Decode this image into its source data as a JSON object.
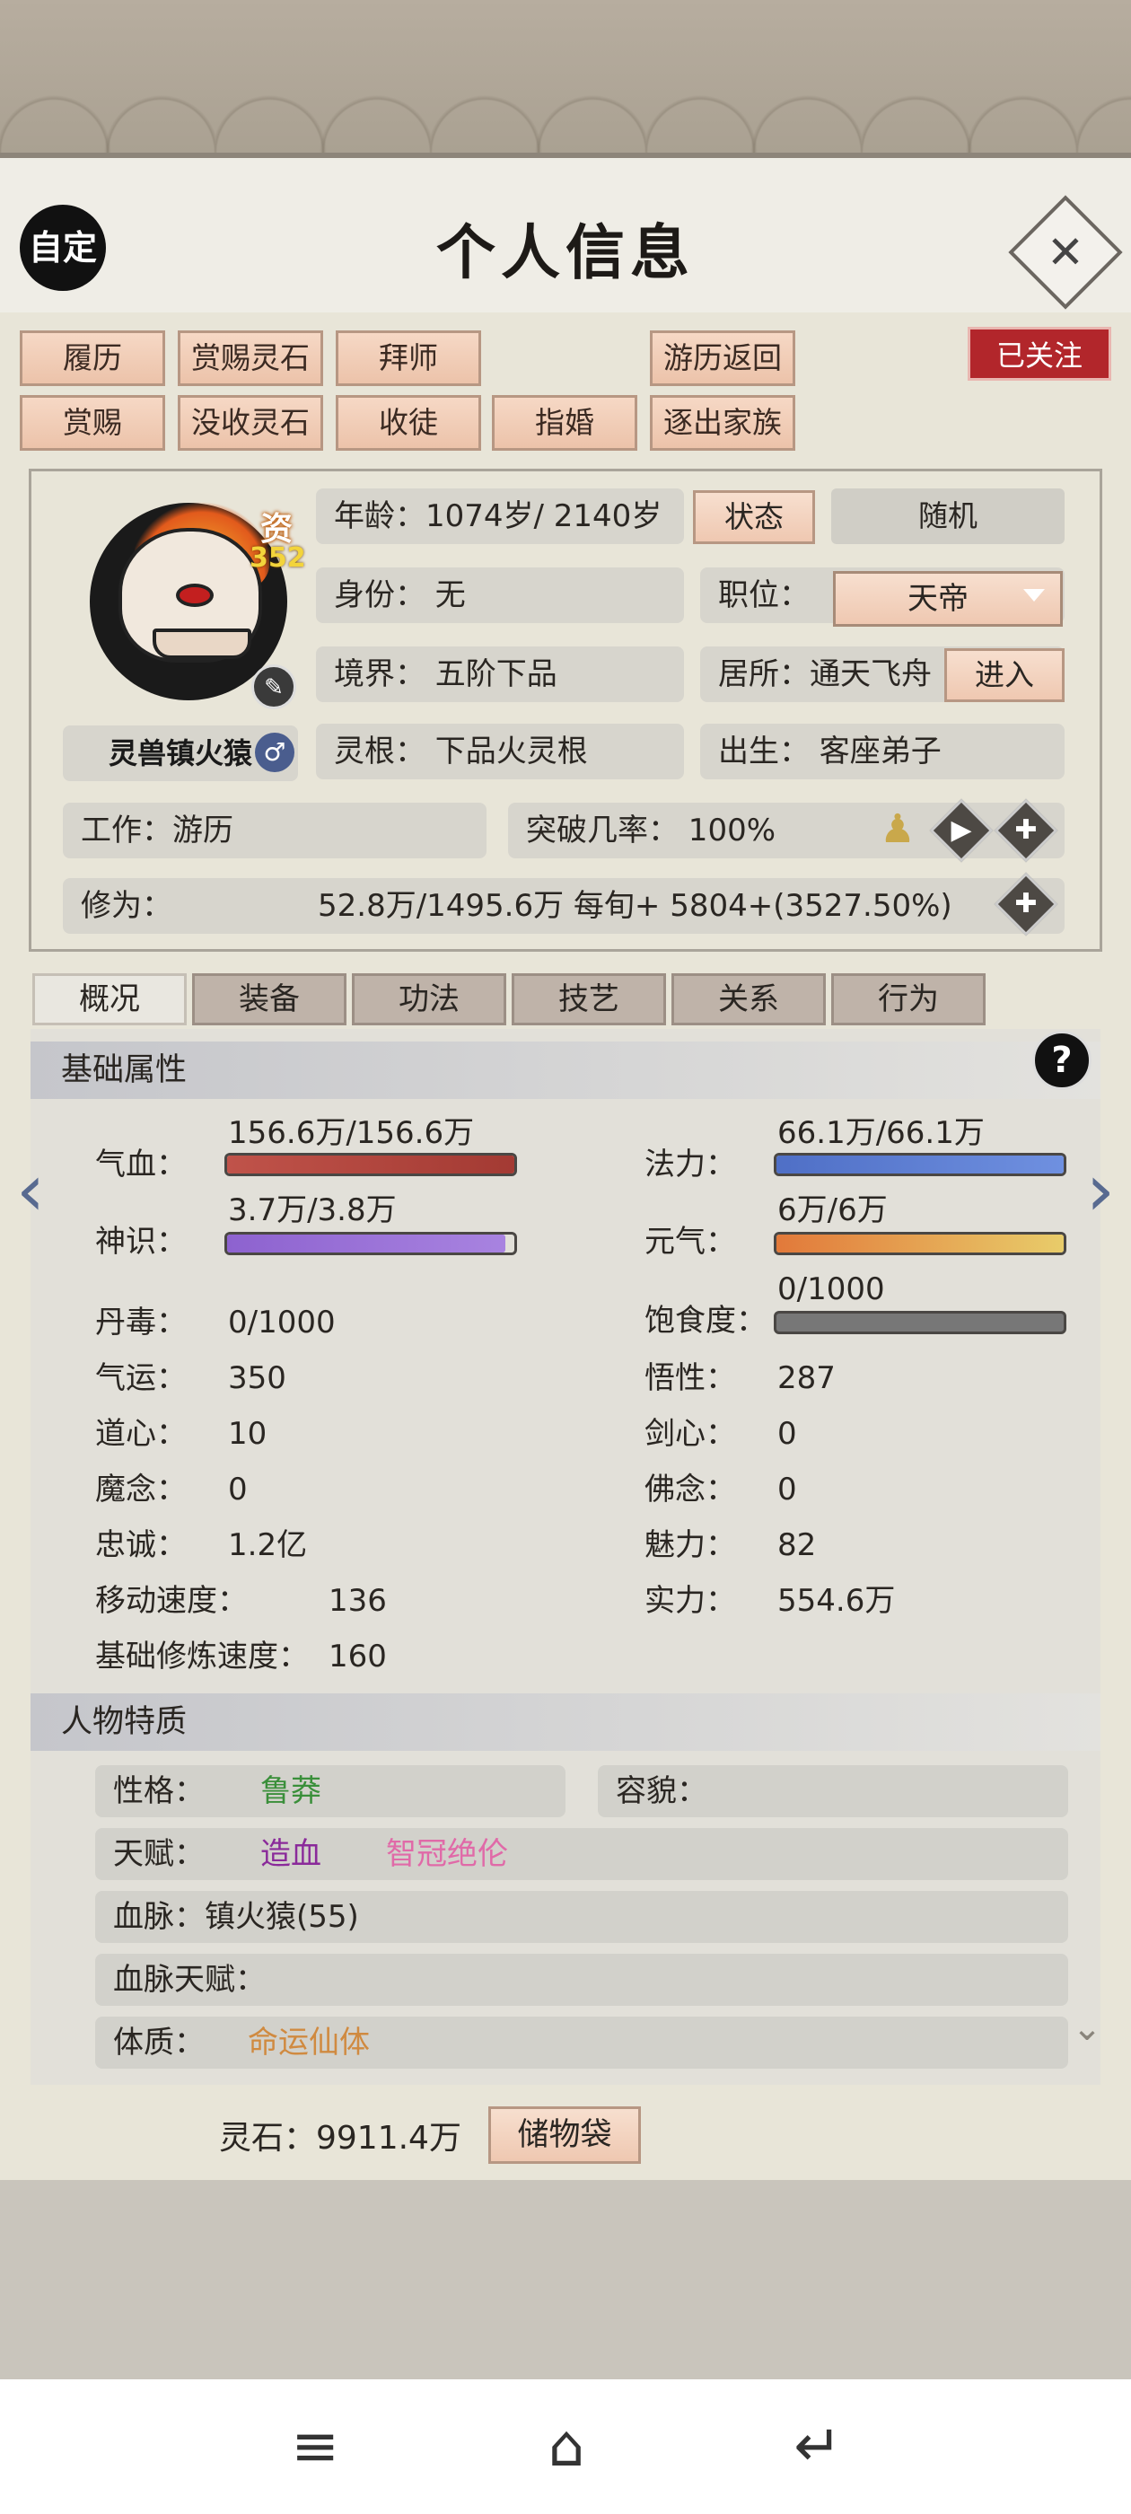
{
  "header": {
    "title": "个人信息",
    "auto_label": "自定",
    "close_icon": "close-icon"
  },
  "action_buttons": {
    "row1": [
      "履历",
      "赏赐灵石",
      "拜师",
      "游历返回"
    ],
    "row2": [
      "赏赐",
      "没收灵石",
      "收徒",
      "指婚",
      "逐出家族"
    ],
    "follow": "已关注"
  },
  "profile": {
    "zi_label": "资",
    "zi_value": "352",
    "beast_name": "灵兽镇火猿",
    "gender_icon": "♂",
    "age": "年龄：1074岁/ 2140岁",
    "status_btn": "状态",
    "random_btn": "随机",
    "identity": "身份：  无",
    "position_label": "职位：",
    "position_value": "天帝",
    "realm": "境界：  五阶下品",
    "residence": "居所：通天飞舟",
    "enter_btn": "进入",
    "spirit_root": "灵根：  下品火灵根",
    "birth": "出生：  客座弟子",
    "job": "工作：游历",
    "breakthrough": "突破几率：  100%",
    "cultivation_label": "修为：",
    "cultivation_value": "52.8万/1495.6万  每旬+  5804+(3527.50%)"
  },
  "tabs": [
    "概况",
    "装备",
    "功法",
    "技艺",
    "关系",
    "行为"
  ],
  "basic": {
    "title": "基础属性",
    "bars": [
      {
        "label": "气血：",
        "text": "156.6万/156.6万",
        "fill": 1.0,
        "color": "#c0534a",
        "color2": "#a33a33"
      },
      {
        "label": "法力：",
        "text": "66.1万/66.1万",
        "fill": 1.0,
        "color": "#4f6fc6",
        "color2": "#6f90e0"
      },
      {
        "label": "神识：",
        "text": "3.7万/3.8万",
        "fill": 0.97,
        "color": "#8d62cf",
        "color2": "#a883e0"
      },
      {
        "label": "元气：",
        "text": "6万/6万",
        "fill": 1.0,
        "color": "#e2793a",
        "color2": "#e8cc6a"
      },
      {
        "label": "饱食度：",
        "text": "0/1000",
        "fill": 0.0,
        "color": "#777",
        "color2": "#777"
      }
    ],
    "left_stats": [
      {
        "label": "丹毒：",
        "value": "0/1000"
      },
      {
        "label": "气运：",
        "value": "350"
      },
      {
        "label": "道心：",
        "value": "10"
      },
      {
        "label": "魔念：",
        "value": "0"
      },
      {
        "label": "忠诚：",
        "value": "1.2亿"
      },
      {
        "label": "移动速度：",
        "value": "136"
      },
      {
        "label": "基础修炼速度：",
        "value": "160"
      }
    ],
    "right_stats": [
      {
        "label": "悟性：",
        "value": "287"
      },
      {
        "label": "剑心：",
        "value": "0"
      },
      {
        "label": "佛念：",
        "value": "0"
      },
      {
        "label": "魅力：",
        "value": "82"
      },
      {
        "label": "实力：",
        "value": "554.6万"
      }
    ]
  },
  "traits": {
    "title": "人物特质",
    "personality_label": "性格：",
    "personality_value": "鲁莽",
    "appearance_label": "容貌：",
    "talent_label": "天赋：",
    "talent_1": "造血",
    "talent_2": "智冠绝伦",
    "bloodline": "血脉：镇火猿(55)",
    "bloodline_talent": "血脉天赋：",
    "physique_label": "体质：",
    "physique_value": "命运仙体"
  },
  "footer": {
    "spirit_stones": "灵石：9911.4万",
    "bag_btn": "储物袋"
  },
  "colors": {
    "accent_red": "#b2262b",
    "trait_green": "#3a8f3a",
    "trait_purple": "#8a2a9a",
    "trait_pink": "#e06aa8",
    "trait_orange": "#d08a40"
  }
}
